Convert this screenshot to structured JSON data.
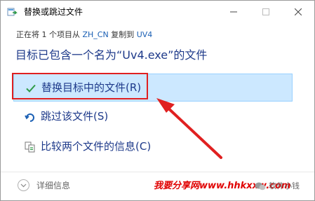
{
  "window": {
    "title": "替换或跳过文件",
    "icons": {
      "app": "file-move-icon",
      "minimize": "minimize-icon",
      "maximize": "maximize-icon",
      "close": "close-icon"
    }
  },
  "copy_info": {
    "prefix": "正在将 1 个项目从 ",
    "source": "ZH_CN",
    "middle": " 复制到 ",
    "destination": "UV4"
  },
  "heading": "目标已包含一个名为“Uv4.exe”的文件",
  "options": [
    {
      "label": "替换目标中的文件(R)",
      "icon": "checkmark-icon",
      "selected": true
    },
    {
      "label": "跳过该文件(S)",
      "icon": "skip-arrow-icon",
      "selected": false
    },
    {
      "label": "比较两个文件的信息(C)",
      "icon": "compare-files-icon",
      "selected": false
    }
  ],
  "footer": {
    "details_label": "详细信息",
    "details_icon": "chevron-down-icon",
    "watermark": "我要分享网www.hhkxxw.com",
    "badge_label": "软件小钱",
    "badge_icon": "wechat-icon"
  },
  "colors": {
    "accent": "#1e3a8a",
    "selected_bg": "#cce8ff",
    "annotation_red": "#e02020",
    "checkmark_green": "#2e9b47"
  }
}
